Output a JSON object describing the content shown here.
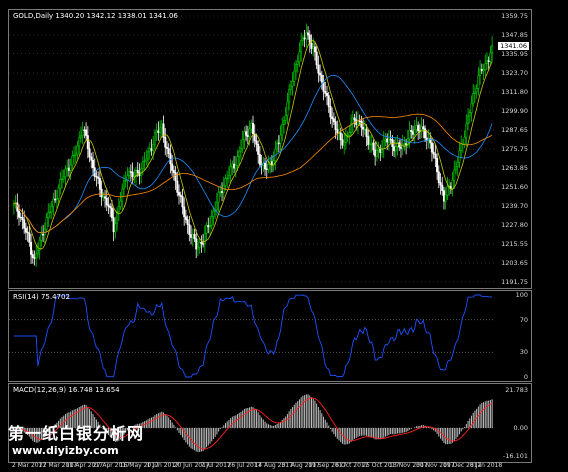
{
  "price_header": "GOLD,Daily  1340.20 1342.12 1338.01 1341.06",
  "current_price": "1341.06",
  "rsi_header": "RSI(14) 75.4702",
  "macd_header": "MACD(12,26,9) 16.748 13.654",
  "watermark": {
    "text": "第一纸白银分析网",
    "url": "www.diyizby.com"
  },
  "colors": {
    "background": "#000000",
    "bull_candle": "#00c800",
    "bear_candle": "#ffffff",
    "ma_fast": "#c8c800",
    "ma_mid": "#1e90ff",
    "ma_slow": "#ff8c00",
    "rsi_line": "#1e50ff",
    "macd_hist": "#c0c0c0",
    "macd_signal": "#ff2020"
  },
  "chart_data": [
    {
      "type": "candlestick",
      "title": "GOLD,Daily",
      "ylim": [
        1191.75,
        1359.75
      ],
      "y_ticks": [
        "1359.75",
        "1347.85",
        "1335.95",
        "1323.70",
        "1311.80",
        "1299.90",
        "1287.65",
        "1275.75",
        "1263.85",
        "1251.60",
        "1239.70",
        "1227.80",
        "1215.55",
        "1203.65",
        "1191.75"
      ],
      "x_ticks": [
        "2 Mar 2017",
        "22 Mar 2017",
        "10 Apr 2017",
        "27 Apr 2017",
        "16 May 2017",
        "1 Jun 2017",
        "20 Jun 2017",
        "7 Jul 2017",
        "26 Jul 2017",
        "14 Aug 2017",
        "31 Aug 2017",
        "19 Sep 2017",
        "6 Oct 2017",
        "25 Oct 2017",
        "13 Nov 2017",
        "30 Nov 2017",
        "19 Dec 2017",
        "8 Jan 2018"
      ],
      "close_anchors": [
        [
          0,
          1240
        ],
        [
          3,
          1236
        ],
        [
          8,
          1220
        ],
        [
          12,
          1205
        ],
        [
          18,
          1228
        ],
        [
          25,
          1248
        ],
        [
          30,
          1262
        ],
        [
          35,
          1270
        ],
        [
          40,
          1290
        ],
        [
          45,
          1268
        ],
        [
          50,
          1250
        ],
        [
          55,
          1240
        ],
        [
          58,
          1226
        ],
        [
          62,
          1244
        ],
        [
          66,
          1262
        ],
        [
          70,
          1258
        ],
        [
          74,
          1264
        ],
        [
          78,
          1272
        ],
        [
          82,
          1284
        ],
        [
          86,
          1290
        ],
        [
          90,
          1270
        ],
        [
          94,
          1256
        ],
        [
          98,
          1238
        ],
        [
          102,
          1224
        ],
        [
          106,
          1214
        ],
        [
          110,
          1218
        ],
        [
          114,
          1230
        ],
        [
          118,
          1242
        ],
        [
          122,
          1254
        ],
        [
          126,
          1262
        ],
        [
          130,
          1270
        ],
        [
          134,
          1284
        ],
        [
          138,
          1290
        ],
        [
          142,
          1272
        ],
        [
          146,
          1262
        ],
        [
          150,
          1268
        ],
        [
          154,
          1280
        ],
        [
          158,
          1300
        ],
        [
          162,
          1320
        ],
        [
          166,
          1338
        ],
        [
          170,
          1350
        ],
        [
          174,
          1338
        ],
        [
          178,
          1322
        ],
        [
          182,
          1306
        ],
        [
          186,
          1292
        ],
        [
          190,
          1280
        ],
        [
          194,
          1284
        ],
        [
          198,
          1296
        ],
        [
          202,
          1290
        ],
        [
          206,
          1282
        ],
        [
          210,
          1272
        ],
        [
          214,
          1278
        ],
        [
          218,
          1282
        ],
        [
          222,
          1276
        ],
        [
          226,
          1278
        ],
        [
          230,
          1284
        ],
        [
          234,
          1290
        ],
        [
          238,
          1286
        ],
        [
          242,
          1280
        ],
        [
          246,
          1262
        ],
        [
          250,
          1244
        ],
        [
          254,
          1254
        ],
        [
          258,
          1268
        ],
        [
          262,
          1286
        ],
        [
          266,
          1304
        ],
        [
          270,
          1322
        ],
        [
          274,
          1328
        ],
        [
          278,
          1341.06
        ]
      ]
    },
    {
      "type": "line",
      "title": "RSI(14)",
      "ylim": [
        0,
        100
      ],
      "y_ticks": [
        "100",
        "70",
        "30",
        "0"
      ],
      "value": 75.4702
    },
    {
      "type": "bar",
      "title": "MACD(12,26,9)",
      "y_ticks": [
        "21.783",
        "0.00",
        "-16.101"
      ],
      "main": 16.748,
      "signal": 13.654
    }
  ]
}
